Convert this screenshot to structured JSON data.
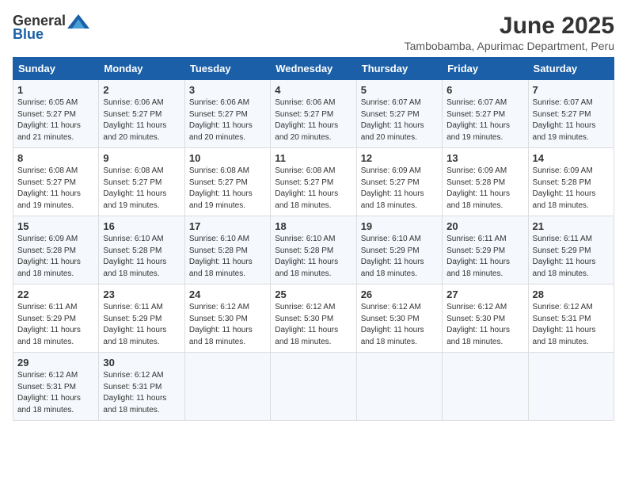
{
  "logo": {
    "general": "General",
    "blue": "Blue"
  },
  "title": "June 2025",
  "subtitle": "Tambobamba, Apurimac Department, Peru",
  "headers": [
    "Sunday",
    "Monday",
    "Tuesday",
    "Wednesday",
    "Thursday",
    "Friday",
    "Saturday"
  ],
  "weeks": [
    [
      {
        "day": "1",
        "sunrise": "Sunrise: 6:05 AM",
        "sunset": "Sunset: 5:27 PM",
        "daylight": "Daylight: 11 hours and 21 minutes."
      },
      {
        "day": "2",
        "sunrise": "Sunrise: 6:06 AM",
        "sunset": "Sunset: 5:27 PM",
        "daylight": "Daylight: 11 hours and 20 minutes."
      },
      {
        "day": "3",
        "sunrise": "Sunrise: 6:06 AM",
        "sunset": "Sunset: 5:27 PM",
        "daylight": "Daylight: 11 hours and 20 minutes."
      },
      {
        "day": "4",
        "sunrise": "Sunrise: 6:06 AM",
        "sunset": "Sunset: 5:27 PM",
        "daylight": "Daylight: 11 hours and 20 minutes."
      },
      {
        "day": "5",
        "sunrise": "Sunrise: 6:07 AM",
        "sunset": "Sunset: 5:27 PM",
        "daylight": "Daylight: 11 hours and 20 minutes."
      },
      {
        "day": "6",
        "sunrise": "Sunrise: 6:07 AM",
        "sunset": "Sunset: 5:27 PM",
        "daylight": "Daylight: 11 hours and 19 minutes."
      },
      {
        "day": "7",
        "sunrise": "Sunrise: 6:07 AM",
        "sunset": "Sunset: 5:27 PM",
        "daylight": "Daylight: 11 hours and 19 minutes."
      }
    ],
    [
      {
        "day": "8",
        "sunrise": "Sunrise: 6:08 AM",
        "sunset": "Sunset: 5:27 PM",
        "daylight": "Daylight: 11 hours and 19 minutes."
      },
      {
        "day": "9",
        "sunrise": "Sunrise: 6:08 AM",
        "sunset": "Sunset: 5:27 PM",
        "daylight": "Daylight: 11 hours and 19 minutes."
      },
      {
        "day": "10",
        "sunrise": "Sunrise: 6:08 AM",
        "sunset": "Sunset: 5:27 PM",
        "daylight": "Daylight: 11 hours and 19 minutes."
      },
      {
        "day": "11",
        "sunrise": "Sunrise: 6:08 AM",
        "sunset": "Sunset: 5:27 PM",
        "daylight": "Daylight: 11 hours and 18 minutes."
      },
      {
        "day": "12",
        "sunrise": "Sunrise: 6:09 AM",
        "sunset": "Sunset: 5:27 PM",
        "daylight": "Daylight: 11 hours and 18 minutes."
      },
      {
        "day": "13",
        "sunrise": "Sunrise: 6:09 AM",
        "sunset": "Sunset: 5:28 PM",
        "daylight": "Daylight: 11 hours and 18 minutes."
      },
      {
        "day": "14",
        "sunrise": "Sunrise: 6:09 AM",
        "sunset": "Sunset: 5:28 PM",
        "daylight": "Daylight: 11 hours and 18 minutes."
      }
    ],
    [
      {
        "day": "15",
        "sunrise": "Sunrise: 6:09 AM",
        "sunset": "Sunset: 5:28 PM",
        "daylight": "Daylight: 11 hours and 18 minutes."
      },
      {
        "day": "16",
        "sunrise": "Sunrise: 6:10 AM",
        "sunset": "Sunset: 5:28 PM",
        "daylight": "Daylight: 11 hours and 18 minutes."
      },
      {
        "day": "17",
        "sunrise": "Sunrise: 6:10 AM",
        "sunset": "Sunset: 5:28 PM",
        "daylight": "Daylight: 11 hours and 18 minutes."
      },
      {
        "day": "18",
        "sunrise": "Sunrise: 6:10 AM",
        "sunset": "Sunset: 5:28 PM",
        "daylight": "Daylight: 11 hours and 18 minutes."
      },
      {
        "day": "19",
        "sunrise": "Sunrise: 6:10 AM",
        "sunset": "Sunset: 5:29 PM",
        "daylight": "Daylight: 11 hours and 18 minutes."
      },
      {
        "day": "20",
        "sunrise": "Sunrise: 6:11 AM",
        "sunset": "Sunset: 5:29 PM",
        "daylight": "Daylight: 11 hours and 18 minutes."
      },
      {
        "day": "21",
        "sunrise": "Sunrise: 6:11 AM",
        "sunset": "Sunset: 5:29 PM",
        "daylight": "Daylight: 11 hours and 18 minutes."
      }
    ],
    [
      {
        "day": "22",
        "sunrise": "Sunrise: 6:11 AM",
        "sunset": "Sunset: 5:29 PM",
        "daylight": "Daylight: 11 hours and 18 minutes."
      },
      {
        "day": "23",
        "sunrise": "Sunrise: 6:11 AM",
        "sunset": "Sunset: 5:29 PM",
        "daylight": "Daylight: 11 hours and 18 minutes."
      },
      {
        "day": "24",
        "sunrise": "Sunrise: 6:12 AM",
        "sunset": "Sunset: 5:30 PM",
        "daylight": "Daylight: 11 hours and 18 minutes."
      },
      {
        "day": "25",
        "sunrise": "Sunrise: 6:12 AM",
        "sunset": "Sunset: 5:30 PM",
        "daylight": "Daylight: 11 hours and 18 minutes."
      },
      {
        "day": "26",
        "sunrise": "Sunrise: 6:12 AM",
        "sunset": "Sunset: 5:30 PM",
        "daylight": "Daylight: 11 hours and 18 minutes."
      },
      {
        "day": "27",
        "sunrise": "Sunrise: 6:12 AM",
        "sunset": "Sunset: 5:30 PM",
        "daylight": "Daylight: 11 hours and 18 minutes."
      },
      {
        "day": "28",
        "sunrise": "Sunrise: 6:12 AM",
        "sunset": "Sunset: 5:31 PM",
        "daylight": "Daylight: 11 hours and 18 minutes."
      }
    ],
    [
      {
        "day": "29",
        "sunrise": "Sunrise: 6:12 AM",
        "sunset": "Sunset: 5:31 PM",
        "daylight": "Daylight: 11 hours and 18 minutes."
      },
      {
        "day": "30",
        "sunrise": "Sunrise: 6:12 AM",
        "sunset": "Sunset: 5:31 PM",
        "daylight": "Daylight: 11 hours and 18 minutes."
      },
      null,
      null,
      null,
      null,
      null
    ]
  ]
}
